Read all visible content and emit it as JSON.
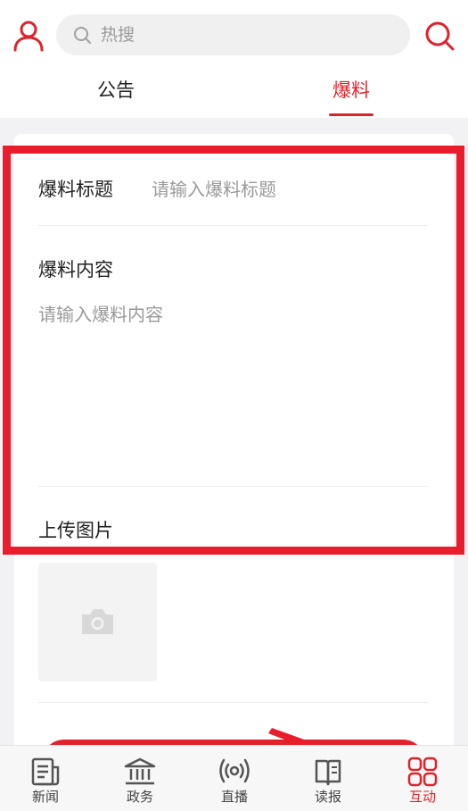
{
  "header": {
    "search": {
      "placeholder": "热搜"
    },
    "tabs": [
      {
        "label": "公告",
        "active": false
      },
      {
        "label": "爆料",
        "active": true
      }
    ]
  },
  "form": {
    "title_label": "爆料标题",
    "title_placeholder": "请输入爆料标题",
    "content_label": "爆料内容",
    "content_placeholder": "请输入爆料内容",
    "upload_label": "上传图片"
  },
  "bottom_nav": [
    {
      "label": "新闻",
      "icon": "newspaper-icon",
      "active": false
    },
    {
      "label": "政务",
      "icon": "government-building-icon",
      "active": false
    },
    {
      "label": "直播",
      "icon": "live-broadcast-icon",
      "active": false
    },
    {
      "label": "读报",
      "icon": "read-paper-icon",
      "active": false
    },
    {
      "label": "互动",
      "icon": "grid-interact-icon",
      "active": true
    }
  ],
  "colors": {
    "accent": "#e0222b",
    "annotation": "#ea1d2c",
    "background": "#f2f2f5"
  }
}
